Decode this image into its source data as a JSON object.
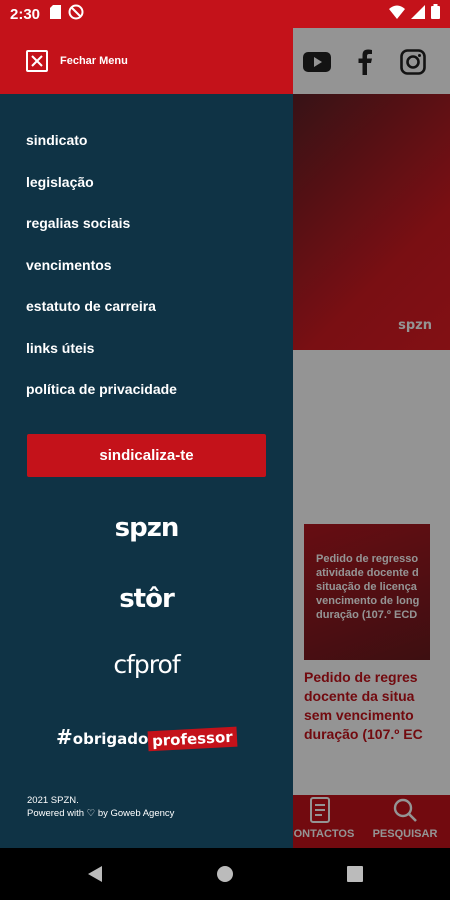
{
  "status_bar": {
    "time": "2:30",
    "left_icons": [
      "sd-card-icon",
      "no-data-icon"
    ],
    "right_icons": [
      "wifi-icon",
      "signal-icon",
      "battery-icon"
    ]
  },
  "drawer": {
    "close_label": "Fechar Menu",
    "menu_items": [
      {
        "label": "sindicato"
      },
      {
        "label": "legislação"
      },
      {
        "label": "regalias sociais"
      },
      {
        "label": "vencimentos"
      },
      {
        "label": "estatuto de carreira"
      },
      {
        "label": "links úteis"
      },
      {
        "label": "política de privacidade"
      }
    ],
    "join_button": "sindicaliza-te",
    "brands": {
      "spzn": "spzn",
      "stor": "stôr",
      "cfprof": "cfprof",
      "hashtag": "#",
      "obrigado": "obrigado",
      "professor": "professor"
    },
    "footer_line1": "2021 SPZN.",
    "footer_line2": "Powered with ♡ by Goweb Agency"
  },
  "background": {
    "social_icons": [
      "youtube-icon",
      "facebook-icon",
      "instagram-icon"
    ],
    "hero_logo": "spzn",
    "card_thumb_lines": [
      "Pedido de regresso",
      "atividade docente d",
      "situação de licença",
      "vencimento de long",
      "duração (107.º ECD"
    ],
    "card_title_lines": [
      "Pedido de regres",
      "docente da situa",
      "sem vencimento",
      "duração (107.º EC"
    ],
    "bottom_nav": {
      "contacts_label": "CONTACTOS",
      "search_label": "PESQUISAR"
    }
  },
  "colors": {
    "brand_red": "#c4121a",
    "drawer_bg": "#0f3345"
  }
}
